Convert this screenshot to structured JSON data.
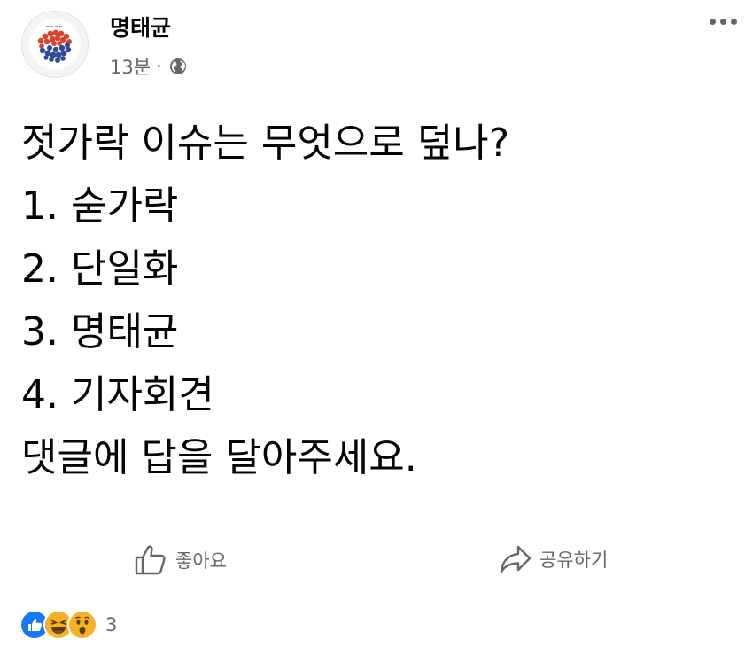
{
  "post": {
    "author": "명태균",
    "time": "13분",
    "separator": "·",
    "privacy_icon": "globe-icon",
    "more_icon": "more-dots-icon",
    "lines": [
      "젓가락 이슈는 무엇으로 덮나?",
      "1. 숟가락",
      "2. 단일화",
      "3. 명태균",
      "4. 기자회견",
      "댓글에 답을 달아주세요."
    ]
  },
  "actions": {
    "like_label": "좋아요",
    "share_label": "공유하기"
  },
  "reactions": {
    "icons": [
      "like-icon",
      "haha-icon",
      "wow-icon"
    ],
    "count": "3"
  },
  "colors": {
    "text": "#050505",
    "secondary": "#65676b",
    "like_blue": "#1877f2",
    "emoji_yellow": "#f7b125"
  }
}
